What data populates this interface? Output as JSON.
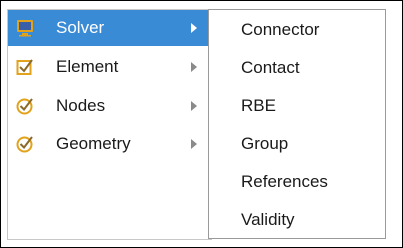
{
  "menu": {
    "items": [
      {
        "label": "Solver",
        "icon": "monitor-icon",
        "active": true
      },
      {
        "label": "Element",
        "icon": "check-square-icon",
        "active": false
      },
      {
        "label": "Nodes",
        "icon": "check-circle-icon",
        "active": false
      },
      {
        "label": "Geometry",
        "icon": "check-circle-icon",
        "active": false
      }
    ]
  },
  "submenu": {
    "items": [
      {
        "label": "Connector"
      },
      {
        "label": "Contact"
      },
      {
        "label": "RBE"
      },
      {
        "label": "Group"
      },
      {
        "label": "References"
      },
      {
        "label": "Validity"
      }
    ]
  },
  "colors": {
    "highlight": "#3a8bd6",
    "icon_accent": "#e2a21a"
  }
}
